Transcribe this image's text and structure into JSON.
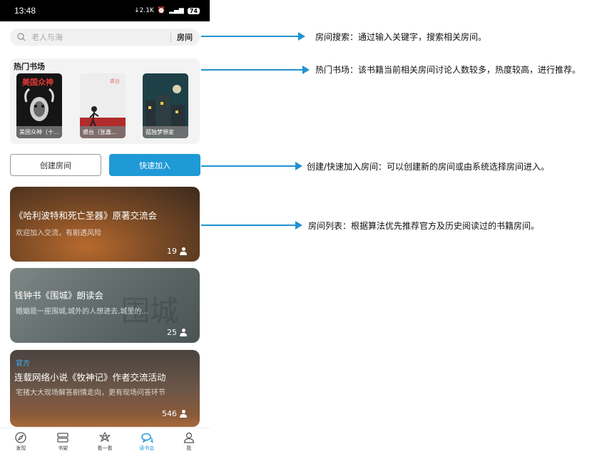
{
  "status_bar": {
    "time": "13:48",
    "speed": "2.1K",
    "battery": "74"
  },
  "search": {
    "placeholder": "老人与海",
    "scope": "房间"
  },
  "hot_market": {
    "title": "热门书场",
    "books": [
      {
        "name": "美国众神（十...",
        "cover_text": "美国众神"
      },
      {
        "name": "裘台（张鑫...",
        "cover_text": "裘台"
      },
      {
        "name": "孤独梦想家",
        "cover_text": "孤独梦想家"
      }
    ]
  },
  "actions": {
    "create": "创建房间",
    "quick_join": "快速加入"
  },
  "rooms": [
    {
      "title": "《哈利波特和死亡圣器》原著交流会",
      "desc": "欢迎加入交流，有剧透风险",
      "count": "19",
      "tag": ""
    },
    {
      "title": "钱钟书《围城》朗读会",
      "desc": "婚姻是一座围城,城外的人想进去,城里的...",
      "count": "25",
      "tag": ""
    },
    {
      "title": "连载网络小说《牧神记》作者交流活动",
      "desc": "宅猪大大现场解答剧情走向，更有现场问答环节",
      "count": "546",
      "tag": "官方"
    }
  ],
  "tabs": [
    {
      "label": "发现",
      "icon": "compass-icon"
    },
    {
      "label": "书架",
      "icon": "bookshelf-icon"
    },
    {
      "label": "看一看",
      "icon": "flower-icon"
    },
    {
      "label": "读书会",
      "icon": "chat-bubbles-icon",
      "active": true
    },
    {
      "label": "我",
      "icon": "person-icon"
    }
  ],
  "annotations": [
    "房间搜索：通过输入关键字，搜索相关房间。",
    "热门书场：该书籍当前相关房间讨论人数较多，热度较高，进行推荐。",
    "创建/快速加入房间：可以创建新的房间或由系统选择房间进入。",
    "房间列表：根据算法优先推荐官方及历史阅读过的书籍房间。"
  ],
  "colors": {
    "accent": "#1f9ad6",
    "annotation": "#2193cf",
    "official_tag": "#3fb0ff"
  }
}
